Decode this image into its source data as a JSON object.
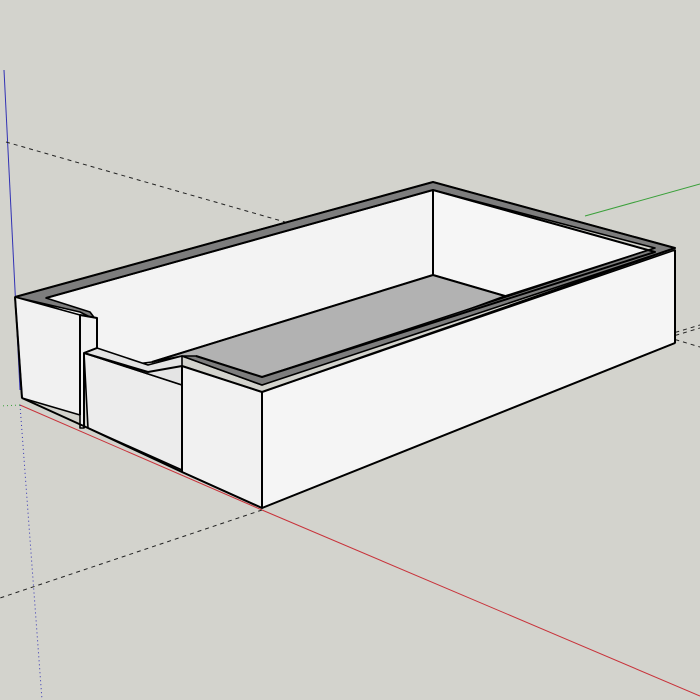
{
  "viewport": {
    "background_color": "#d3d3cd",
    "axis_colors": {
      "red": "#c8323a",
      "green": "#3aa03a",
      "blue": "#3232b4",
      "inference": "#222222"
    }
  },
  "model": {
    "kind": "open rectangular tray with a notched front wall",
    "fill_colors": {
      "wall_face": "#f1f1f1",
      "inner_floor": "#b0b0b0",
      "rim_edge": "#7a7a7a",
      "outline": "#000000"
    }
  }
}
